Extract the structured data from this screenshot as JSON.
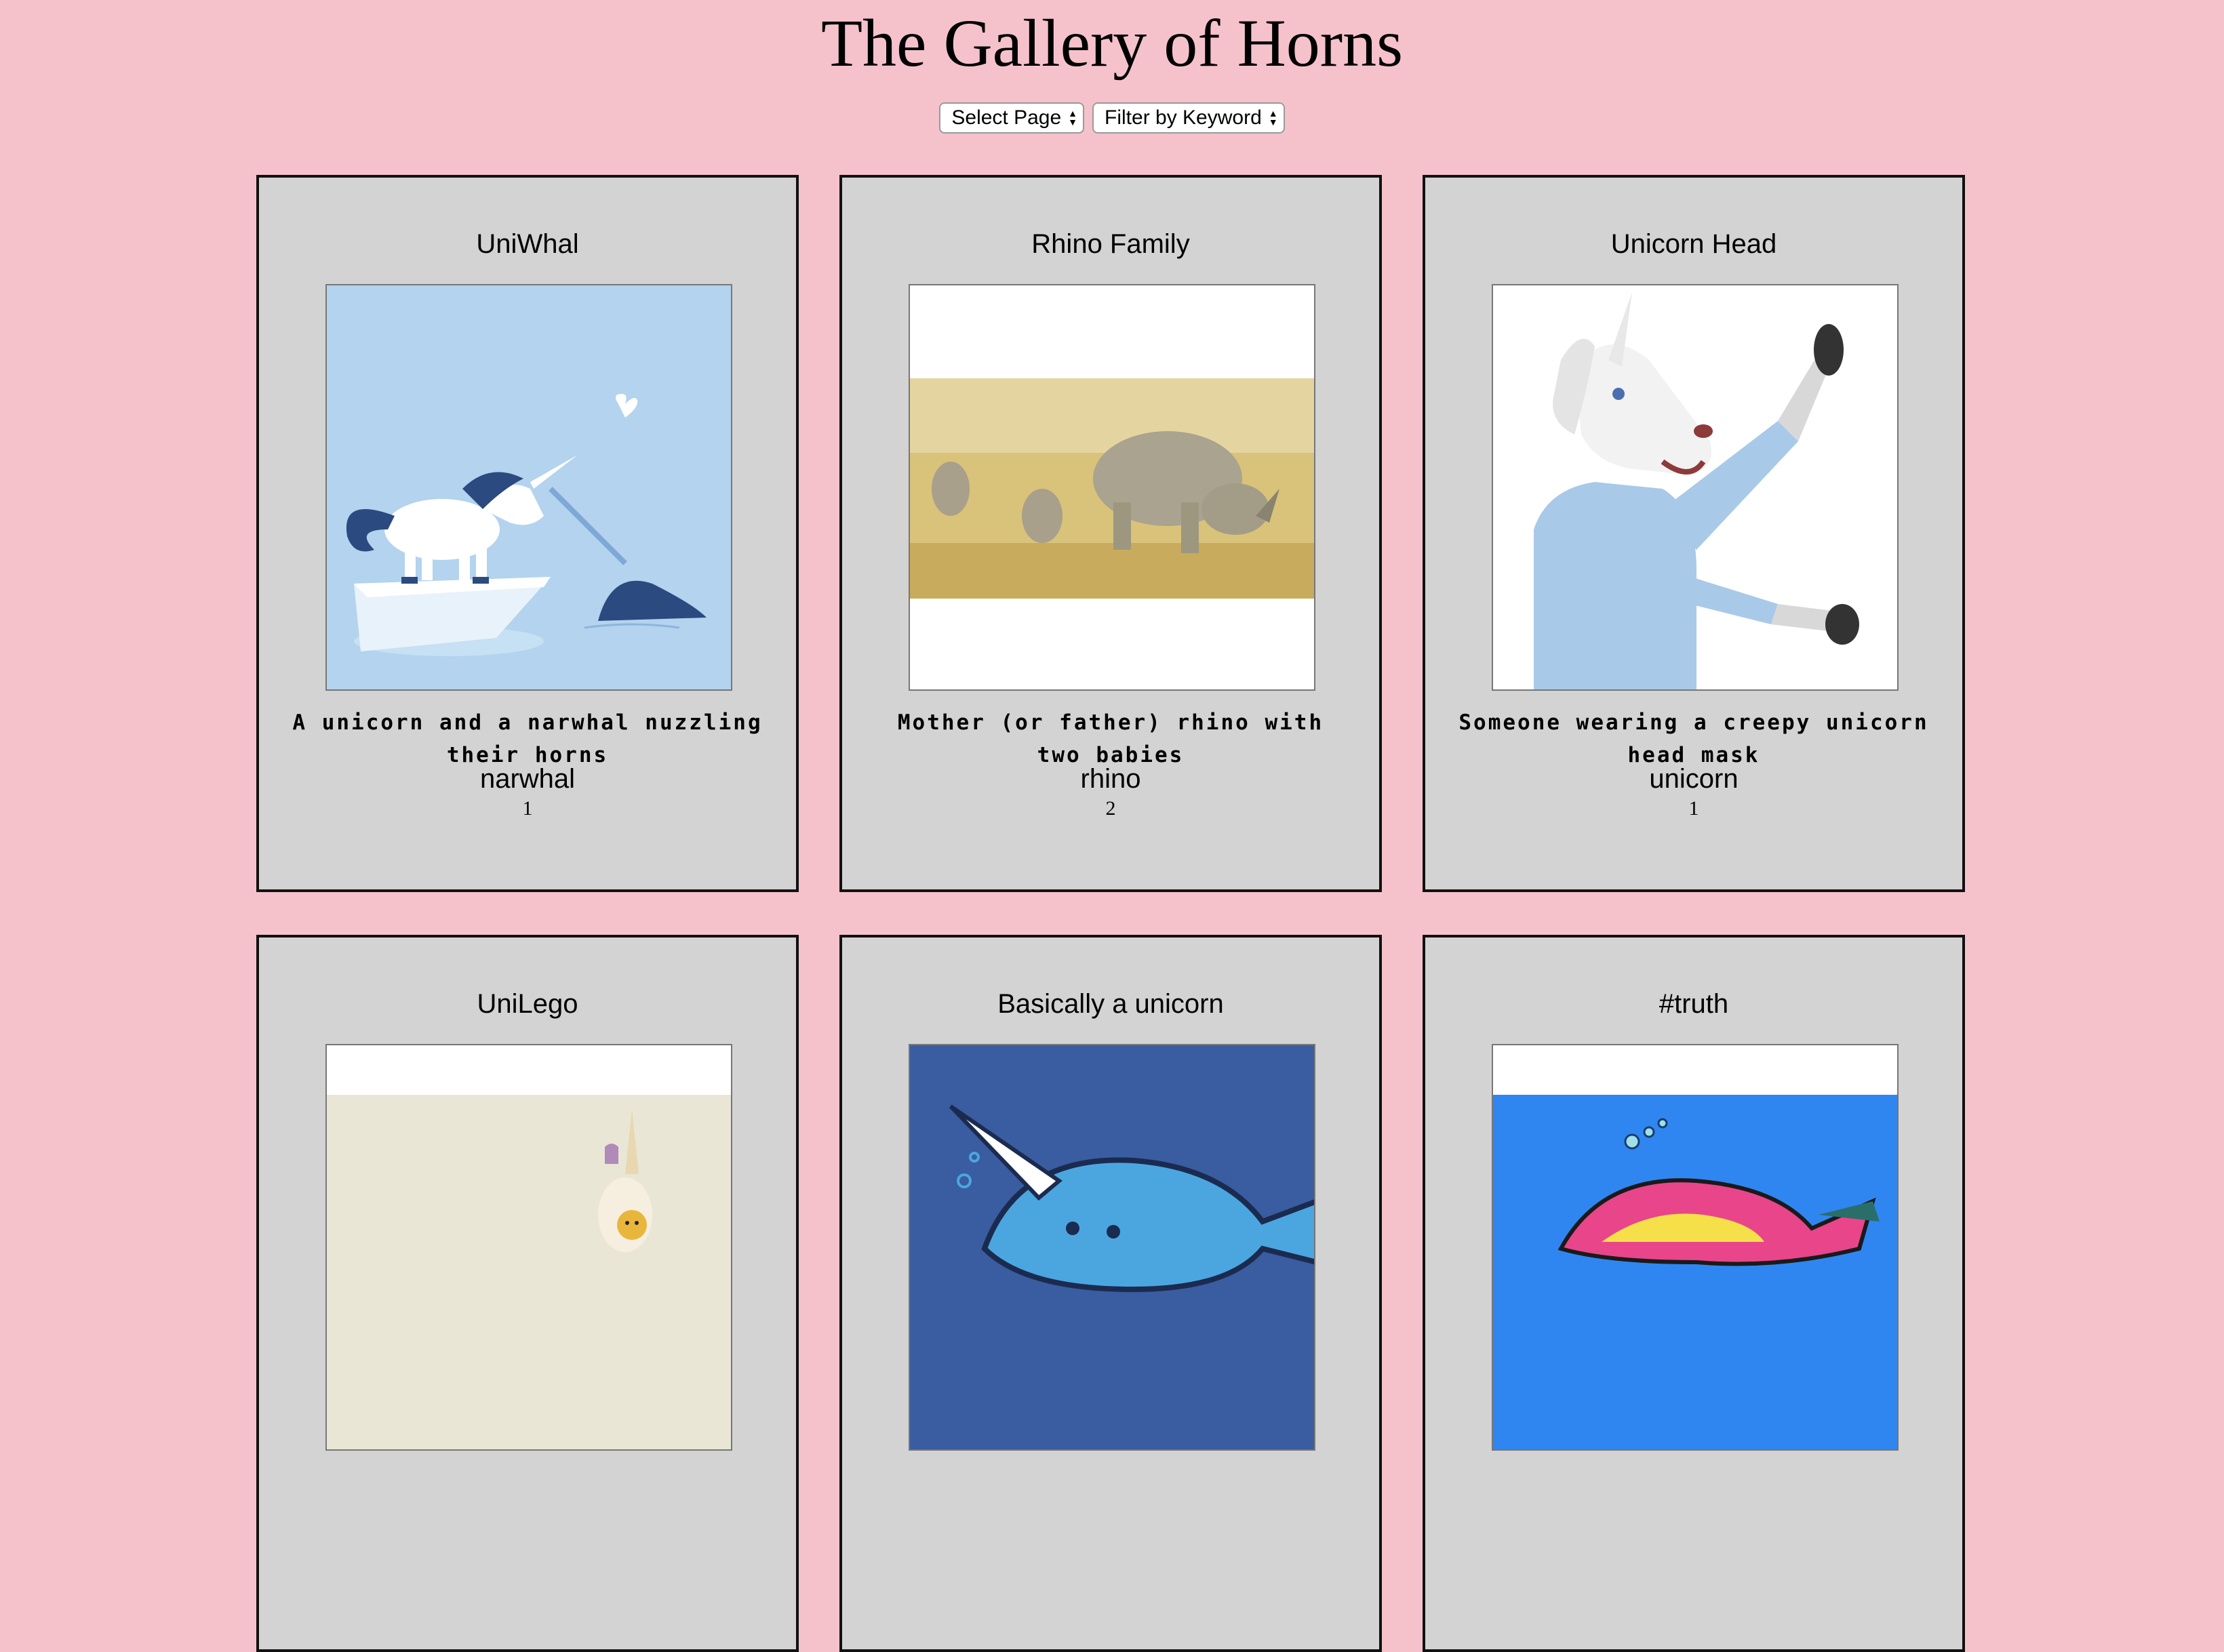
{
  "page": {
    "title": "The Gallery of Horns"
  },
  "controls": {
    "page_select": "Select Page",
    "keyword_select": "Filter by Keyword"
  },
  "cards": [
    {
      "title": "UniWhal",
      "description": "A unicorn and a narwhal nuzzling their horns",
      "keyword": "narwhal",
      "horns": "1"
    },
    {
      "title": "Rhino Family",
      "description": "Mother (or father) rhino with two babies",
      "keyword": "rhino",
      "horns": "2"
    },
    {
      "title": "Unicorn Head",
      "description": "Someone wearing a creepy unicorn head mask",
      "keyword": "unicorn",
      "horns": "1"
    },
    {
      "title": "UniLego"
    },
    {
      "title": "Basically a unicorn"
    },
    {
      "title": "#truth"
    }
  ]
}
